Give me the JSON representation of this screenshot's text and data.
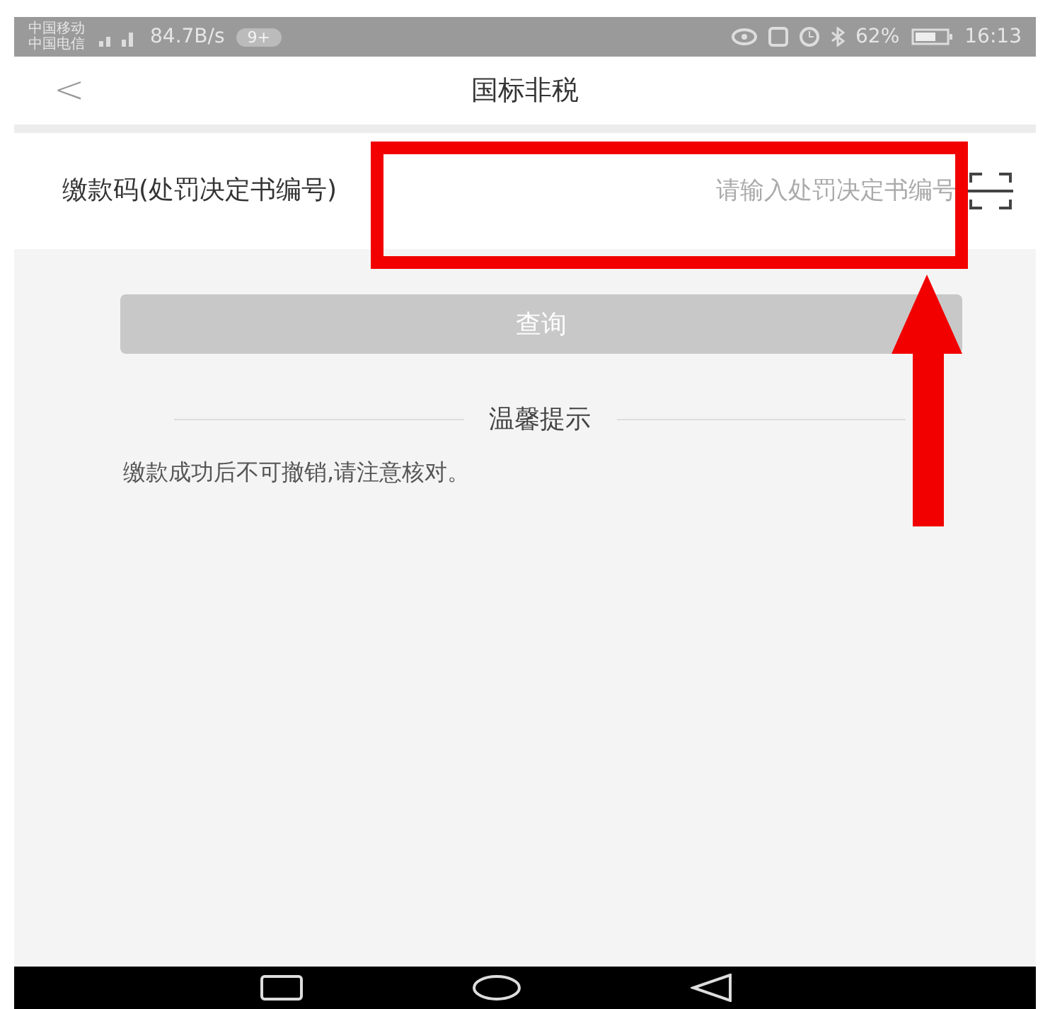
{
  "status_bar": {
    "carriers": [
      "中国移动",
      "中国电信"
    ],
    "speed": "84.7B/s",
    "badge": "9+",
    "battery_percent": "62%",
    "time": "16:13"
  },
  "nav_bar": {
    "back": "<",
    "title": "国标非税"
  },
  "form": {
    "label": "缴款码(处罚决定书编号)",
    "placeholder": "请输入处罚决定书编号"
  },
  "query_button": {
    "label": "查询",
    "disabled": true
  },
  "tips": {
    "heading": "温馨提示",
    "text": "缴款成功后不可撤销,请注意核对。"
  }
}
